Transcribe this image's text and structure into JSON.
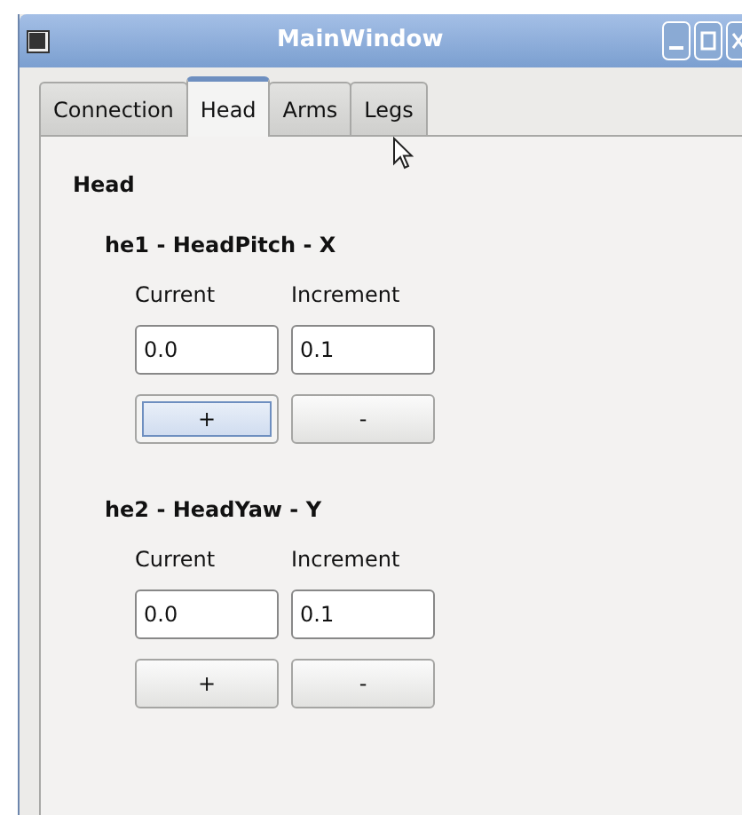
{
  "window": {
    "title": "MainWindow"
  },
  "tabs": [
    {
      "label": "Connection",
      "selected": false
    },
    {
      "label": "Head",
      "selected": true
    },
    {
      "label": "Arms",
      "selected": false
    },
    {
      "label": "Legs",
      "selected": false
    }
  ],
  "panel": {
    "heading": "Head",
    "joints": [
      {
        "title": "he1 - HeadPitch - X",
        "current_label": "Current",
        "increment_label": "Increment",
        "current": "0.0",
        "increment": "0.1",
        "plus": {
          "label": "+",
          "focused": true
        },
        "minus": {
          "label": "-",
          "focused": false
        }
      },
      {
        "title": "he2 - HeadYaw - Y",
        "current_label": "Current",
        "increment_label": "Increment",
        "current": "0.0",
        "increment": "0.1",
        "plus": {
          "label": "+",
          "focused": false
        },
        "minus": {
          "label": "-",
          "focused": false
        }
      }
    ]
  }
}
